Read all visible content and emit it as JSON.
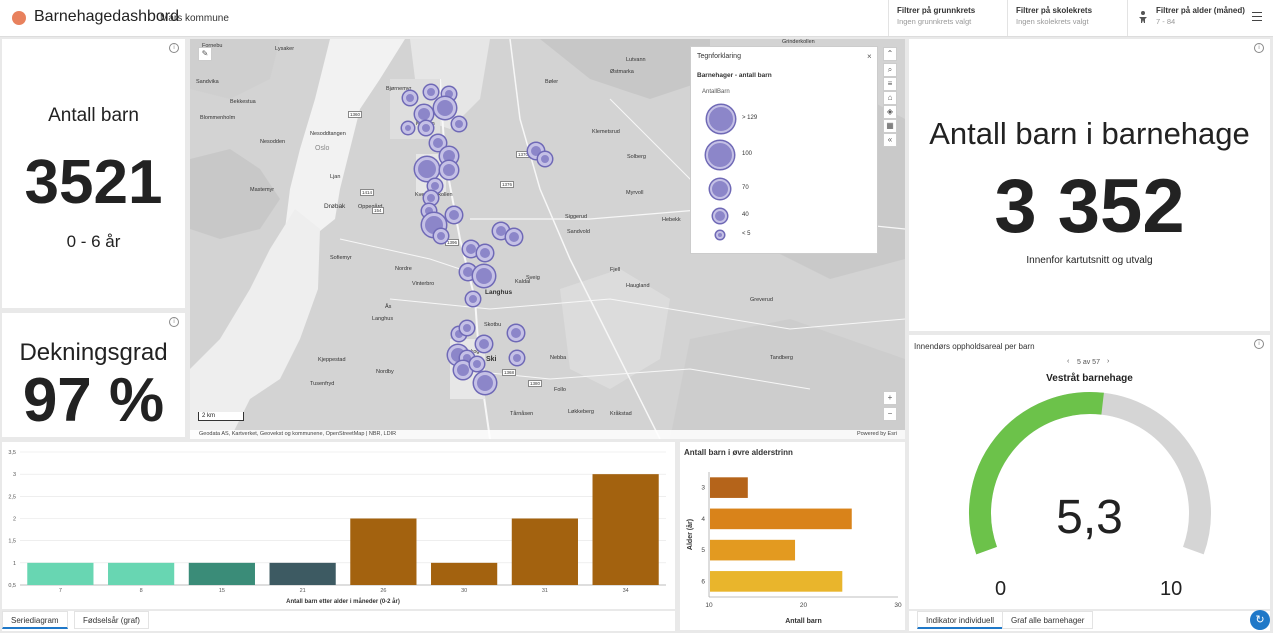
{
  "header": {
    "title": "Barnehagedashbord",
    "subtitle": "Mars kommune",
    "filters": [
      {
        "label": "Filtrer på grunnkrets",
        "value": "Ingen grunnkrets valgt"
      },
      {
        "label": "Filtrer på skolekrets",
        "value": "Ingen skolekrets valgt"
      },
      {
        "label": "Filtrer på alder (måned)",
        "value": "7 - 84"
      }
    ]
  },
  "antall_barn": {
    "label": "Antall barn",
    "value": "3521",
    "range": "0 - 6 år"
  },
  "dekningsgrad": {
    "label": "Dekningsgrad",
    "value": "97 %"
  },
  "barn_i_barnehage": {
    "label": "Antall barn i barnehage",
    "value": "3 352",
    "caption": "Innenfor kartutsnitt og utvalg"
  },
  "map": {
    "scalebar": "2 km",
    "attribution": "Geodata AS, Kartverket, Geovekst og kommunene, OpenStreetMap | NBR, LDIR",
    "powered": "Powered by Esri",
    "place_labels": [
      "Grinderkollen",
      "Lysaker",
      "Fornebu",
      "Blommenholm",
      "Nesodden",
      "Oslo",
      "Ljan",
      "Sandvika",
      "Bekkestua",
      "Hvalstad",
      "Nesoddtangen",
      "Bjørnemyr",
      "Oppegård",
      "Ås",
      "Ski",
      "Langhus",
      "Kolbotn",
      "Bøler",
      "Hauketo",
      "Østmarka",
      "Lutvann",
      "Klemetsrud",
      "Mastemyr",
      "Nordby",
      "Follo",
      "Kråkstad",
      "Vestby",
      "Drøbak",
      "Siggerud",
      "Sandvold",
      "Hebekk",
      "Greverud",
      "Kroer",
      "Nordre Frogn",
      "Kaldal",
      "Tandberg",
      "Myrvoll",
      "Sofiemyr",
      "Tårnåsen",
      "Kvernhuskollen",
      "Solberg",
      "Skotbu",
      "Svartskog",
      "Tusenfryd",
      "Vinterbro",
      "Nordre",
      "Langhus",
      "Kjeppestad",
      "Rudskollen",
      "Årungen",
      "Bøler",
      "Prinsdal",
      "Fagerstrand",
      "Sveig",
      "Bjørnestad",
      "Ekebergskrenten",
      "Løkkeberg",
      "Haugland",
      "Fjell",
      "Nebba",
      "Oppsand",
      "Bru",
      "Bråtan"
    ],
    "road_numbers": [
      "1414",
      "1370",
      "1376",
      "1396",
      "154",
      "1368",
      "1360",
      "1380",
      "1372",
      "1322",
      "1334"
    ]
  },
  "legend": {
    "title": "Tegnforklaring",
    "layer": "Barnehager - antall barn",
    "field": "AntallBarn",
    "items": [
      "> 129",
      "100",
      "70",
      "40",
      "< 5"
    ]
  },
  "bar_chart": {
    "xlabel": "Antall barn etter alder i måneder (0-2 år)",
    "chart_data": {
      "type": "bar",
      "categories": [
        "7",
        "8",
        "15",
        "21",
        "26",
        "30",
        "31",
        "34"
      ],
      "values": [
        1,
        1,
        1,
        1,
        2,
        1,
        2,
        3
      ],
      "colors": [
        "#68d6b2",
        "#68d6b2",
        "#3a8c78",
        "#3d5a62",
        "#a3620f",
        "#a3620f",
        "#a3620f",
        "#a3620f"
      ],
      "ylim": [
        0.5,
        3.5
      ],
      "yticks": [
        "0,5",
        "1",
        "1,5",
        "2",
        "2,5",
        "3",
        "3,5"
      ],
      "xlabel": "Antall barn etter alder i måneder (0-2 år)",
      "ylabel": ""
    },
    "tabs": [
      "Seriediagram",
      "Fødselsår (graf)"
    ]
  },
  "hbar_chart": {
    "title": "Antall barn i øvre alderstrinn",
    "chart_data": {
      "type": "bar",
      "orientation": "horizontal",
      "categories": [
        "3",
        "4",
        "5",
        "6"
      ],
      "values": [
        14,
        25,
        19,
        24
      ],
      "colors": [
        "#b5641a",
        "#d9831a",
        "#e39a20",
        "#e9b52c"
      ],
      "xlim": [
        10,
        30
      ],
      "xticks": [
        "10",
        "20",
        "30"
      ],
      "xlabel": "Antall barn",
      "ylabel": "Alder (år)"
    }
  },
  "gauge": {
    "title": "Innendørs oppholdsareal per barn",
    "pager": "5 av 57",
    "name": "Vestråt barnehage",
    "value": "5,3",
    "min_label": "0",
    "max_label": "10",
    "chart_data": {
      "type": "gauge",
      "value": 5.3,
      "min": 0,
      "max": 10
    },
    "colors": {
      "fill": "#6cc24a",
      "track": "#d5d5d5"
    },
    "tabs": [
      "Indikator individuell",
      "Graf alle barnehager"
    ]
  }
}
